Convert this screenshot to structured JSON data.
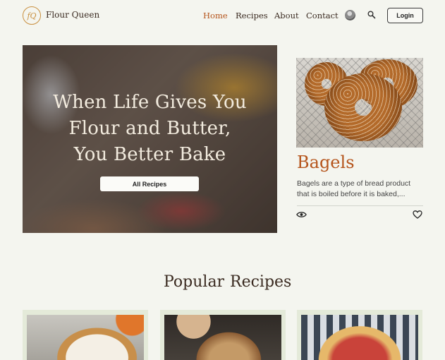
{
  "header": {
    "logo_text": "fQ",
    "brand": "Flour Queen",
    "nav": [
      {
        "label": "Home",
        "active": true
      },
      {
        "label": "Recipes",
        "active": false
      },
      {
        "label": "About",
        "active": false
      },
      {
        "label": "Contact",
        "active": false
      }
    ],
    "avatar_icon": "user-avatar",
    "search_icon": "search-icon",
    "login_label": "Login"
  },
  "hero": {
    "title_lines": [
      "When Life Gives You",
      "Flour and Butter,",
      "You Better Bake"
    ],
    "button_label": "All Recipes"
  },
  "featured": {
    "title": "Bagels",
    "description_lines": [
      "Bagels are a type of bread product",
      "that is boiled before it is baked,..."
    ],
    "view_icon": "eye-icon",
    "like_icon": "heart-icon"
  },
  "popular": {
    "title_words": [
      "Popular",
      "Recipes"
    ],
    "cards": [
      {
        "image": "pie-icon"
      },
      {
        "image": "bread-icon"
      },
      {
        "image": "pizza-icon"
      }
    ]
  },
  "colors": {
    "accent": "#b5541b",
    "background": "#f4f5ef",
    "card_background": "#e4ead9"
  }
}
